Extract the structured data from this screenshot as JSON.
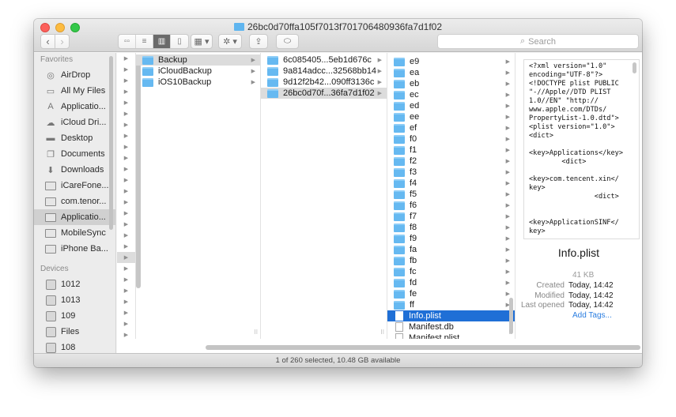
{
  "window": {
    "title": "26bc0d70ffa105f7013f701706480936fa7d1f02"
  },
  "toolbar": {
    "back_glyph": "‹",
    "forward_glyph": "›",
    "view_icons": [
      "▫▫",
      "≡",
      "▥",
      "▯"
    ],
    "arrange_glyph": "▦ ▾",
    "action_glyph": "✲ ▾",
    "share_glyph": "⇪",
    "tag_glyph": "⬭",
    "search_icon": "⌕",
    "search_placeholder": "Search"
  },
  "sidebar": {
    "favorites_label": "Favorites",
    "favorites": [
      {
        "label": "AirDrop",
        "icon": "airdrop-icon",
        "glyph": "◎"
      },
      {
        "label": "All My Files",
        "icon": "all-my-files-icon",
        "glyph": "▭"
      },
      {
        "label": "Applicatio...",
        "icon": "applications-icon",
        "glyph": "A"
      },
      {
        "label": "iCloud Dri...",
        "icon": "icloud-icon",
        "glyph": "☁"
      },
      {
        "label": "Desktop",
        "icon": "desktop-icon",
        "glyph": "▬"
      },
      {
        "label": "Documents",
        "icon": "documents-icon",
        "glyph": "❐"
      },
      {
        "label": "Downloads",
        "icon": "downloads-icon",
        "glyph": "⬇"
      },
      {
        "label": "iCareFone...",
        "icon": "folder-icon",
        "glyph": ""
      },
      {
        "label": "com.tenor...",
        "icon": "folder-icon",
        "glyph": ""
      },
      {
        "label": "Applicatio...",
        "icon": "folder-icon",
        "glyph": "",
        "selected": true
      },
      {
        "label": "MobileSync",
        "icon": "folder-icon",
        "glyph": ""
      },
      {
        "label": "iPhone Ba...",
        "icon": "folder-icon",
        "glyph": ""
      }
    ],
    "devices_label": "Devices",
    "devices": [
      {
        "label": "1012"
      },
      {
        "label": "1013"
      },
      {
        "label": "109"
      },
      {
        "label": "Files"
      },
      {
        "label": "108"
      }
    ]
  },
  "columns": {
    "col1": [
      {
        "name": "Backup",
        "selected": true
      },
      {
        "name": "iCloudBackup"
      },
      {
        "name": "iOS10Backup"
      }
    ],
    "col2": [
      {
        "name": "6c085405...5eb1d676c"
      },
      {
        "name": "9a814adcc...32568bb14"
      },
      {
        "name": "9d12f2b42...090ff3136c"
      },
      {
        "name": "26bc0d70f...36fa7d1f02",
        "selected": true
      }
    ],
    "col3_folders": [
      "e9",
      "ea",
      "eb",
      "ec",
      "ed",
      "ee",
      "ef",
      "f0",
      "f1",
      "f2",
      "f3",
      "f4",
      "f5",
      "f6",
      "f7",
      "f8",
      "f9",
      "fa",
      "fb",
      "fc",
      "fd",
      "fe",
      "ff"
    ],
    "col3_files": [
      {
        "name": "Info.plist",
        "selected": true
      },
      {
        "name": "Manifest.db"
      },
      {
        "name": "Manifest.plist"
      }
    ]
  },
  "preview": {
    "content": "<?xml version=\"1.0\"\nencoding=\"UTF-8\"?>\n<!DOCTYPE plist PUBLIC\n\"-//Apple//DTD PLIST\n1.0//EN\" \"http://\nwww.apple.com/DTDs/\nPropertyList-1.0.dtd\">\n<plist version=\"1.0\">\n<dict>\n\n<key>Applications</key>\n        <dict>\n\n<key>com.tencent.xin</\nkey>\n                <dict>\n\n\n<key>ApplicationSINF</\nkey>\n\n\n        <data>",
    "filename": "Info.plist",
    "size": "41 KB",
    "meta": [
      {
        "key": "Created",
        "value": "Today, 14:42"
      },
      {
        "key": "Modified",
        "value": "Today, 14:42"
      },
      {
        "key": "Last opened",
        "value": "Today, 14:42"
      }
    ],
    "add_tags": "Add Tags..."
  },
  "status": {
    "text": "1 of 260 selected, 10.48 GB available"
  }
}
